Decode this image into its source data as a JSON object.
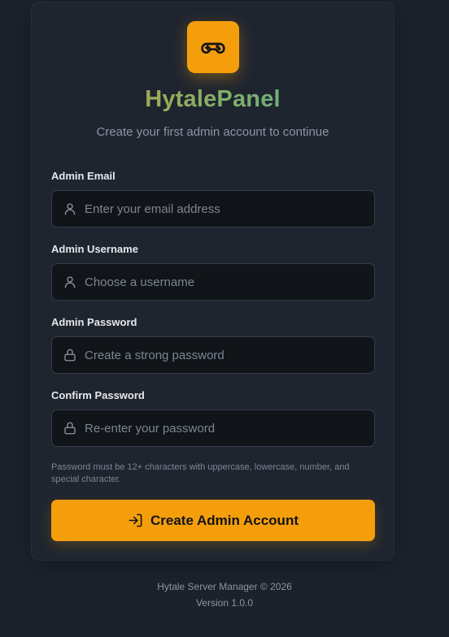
{
  "brand": {
    "name": "HytalePanel",
    "subtitle": "Create your first admin account to continue",
    "logo_icon": "gamepad-icon",
    "accent_color": "#f59e0b"
  },
  "form": {
    "email": {
      "label": "Admin Email",
      "placeholder": "Enter your email address",
      "value": "",
      "icon": "user-icon"
    },
    "username": {
      "label": "Admin Username",
      "placeholder": "Choose a username",
      "value": "",
      "icon": "user-icon"
    },
    "password": {
      "label": "Admin Password",
      "placeholder": "Create a strong password",
      "value": "",
      "icon": "lock-icon"
    },
    "confirm": {
      "label": "Confirm Password",
      "placeholder": "Re-enter your password",
      "value": "",
      "icon": "lock-icon"
    },
    "hint": "Password must be 12+ characters with uppercase, lowercase, number, and special character.",
    "submit_label": "Create Admin Account",
    "submit_icon": "login-icon"
  },
  "footer": {
    "copyright": "Hytale Server Manager © 2026",
    "version": "Version 1.0.0"
  }
}
